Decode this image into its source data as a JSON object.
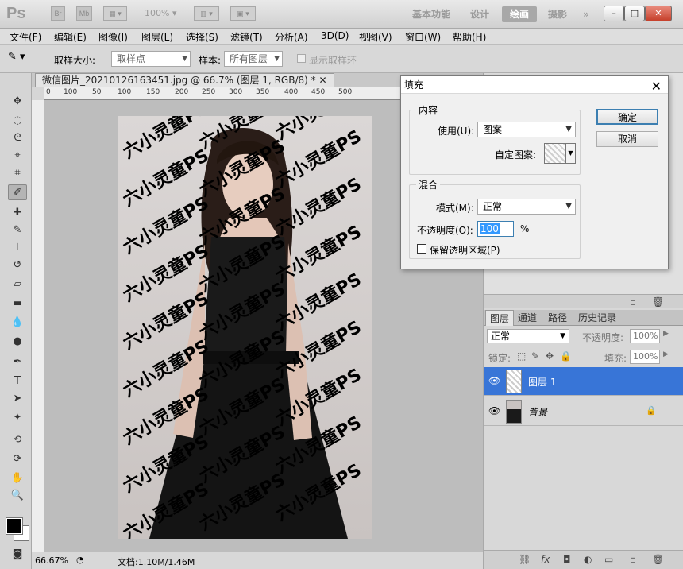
{
  "titlebar": {
    "app_logo": "Ps",
    "bridge": "Br",
    "minibridge": "Mb",
    "zoom": "100%",
    "workspaces": [
      "基本功能",
      "设计",
      "绘画",
      "摄影",
      "»"
    ],
    "active_workspace": "绘画",
    "window_controls": [
      "–",
      "□",
      "✕"
    ]
  },
  "menu": [
    "文件(F)",
    "编辑(E)",
    "图像(I)",
    "图层(L)",
    "选择(S)",
    "滤镜(T)",
    "分析(A)",
    "3D(D)",
    "视图(V)",
    "窗口(W)",
    "帮助(H)"
  ],
  "options": {
    "sample_size_label": "取样大小:",
    "sample_size_value": "取样点",
    "sample_label": "样本:",
    "sample_value": "所有图层",
    "show_ring_label": "显示取样环"
  },
  "document": {
    "tab_title": "微信图片_20210126163451.jpg @ 66.7% (图层 1, RGB/8) *",
    "ruler_marks": [
      "0",
      "100",
      "50",
      "100",
      "150",
      "200",
      "250",
      "300",
      "350",
      "400",
      "450",
      "500"
    ],
    "watermark": "六小灵童PS",
    "zoom": "66.67%",
    "doc_size": "文档:1.10M/1.46M"
  },
  "annotations": [
    "①",
    "②"
  ],
  "fill_dialog": {
    "title": "填充",
    "close": "✕",
    "content_legend": "内容",
    "use_label": "使用(U):",
    "use_value": "图案",
    "custom_pattern_label": "自定图案:",
    "blend_legend": "混合",
    "mode_label": "模式(M):",
    "mode_value": "正常",
    "opacity_label": "不透明度(O):",
    "opacity_value": "100",
    "opacity_unit": "%",
    "preserve_label": "保留透明区域(P)",
    "ok": "确定",
    "cancel": "取消"
  },
  "layers_panel": {
    "tabs": [
      "图层",
      "通道",
      "路径",
      "历史记录"
    ],
    "blend_mode": "正常",
    "opacity_label": "不透明度:",
    "opacity_value": "100%",
    "lock_label": "锁定:",
    "fill_label": "填充:",
    "fill_value": "100%",
    "layers": [
      {
        "name": "图层 1",
        "selected": true
      },
      {
        "name": "背景",
        "selected": false
      }
    ]
  }
}
